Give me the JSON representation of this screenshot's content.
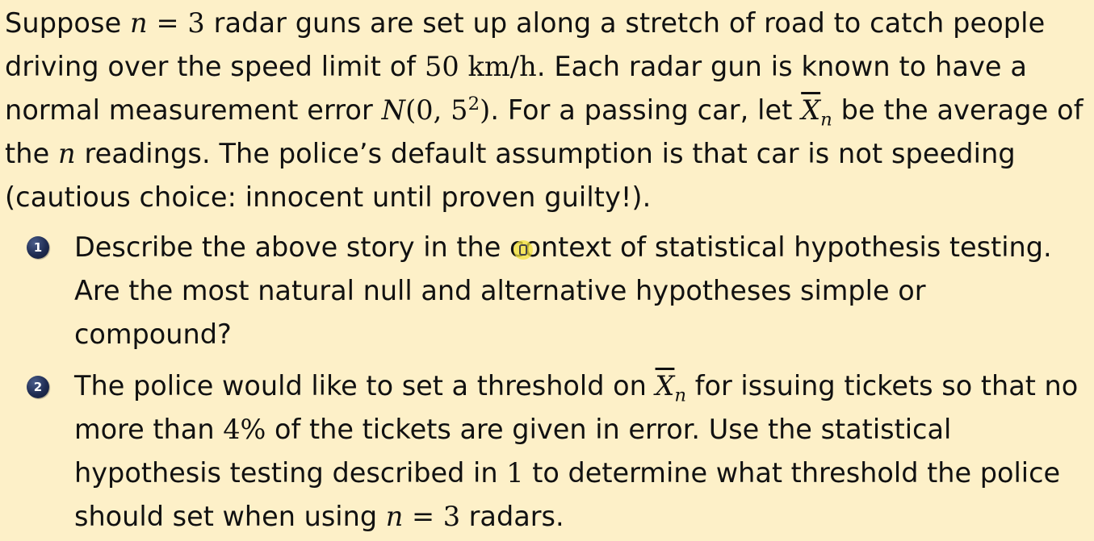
{
  "intro": {
    "s1": "Suppose ",
    "n1": "n",
    "eq1": " = 3",
    "s2": " radar guns are set up along a stretch of road to catch people driving over the speed limit of ",
    "speed": "50 km/h",
    "s3": ". Each radar gun is known to have a normal measurement error ",
    "dist": "N",
    "dist_args": "(0, 5",
    "dist_exp": "2",
    "dist_close": ")",
    "s4": ". For a passing car, let ",
    "xbar": "X",
    "xbar_sub": "n",
    "s5": " be the average of the ",
    "n2": "n",
    "s6": " readings. The police’s default assumption is that car is not speeding (cautious choice: innocent until proven guilty!)."
  },
  "items": [
    {
      "number": "1",
      "text": "Describe the above story in the context of statistical hypothesis testing. Are the most natural null and alternative hypotheses simple or compound?"
    },
    {
      "number": "2",
      "t1": "The police would like to set a threshold on ",
      "xbar": "X",
      "xbar_sub": "n",
      "t2": " for issuing tickets so that no more than ",
      "pct": "4%",
      "t3": " of the tickets are given in error. Use the statistical hypothesis testing described in ",
      "ref": "1",
      "t4": " to determine what threshold the police should set when using ",
      "n": "n",
      "eq": " = 3",
      "t5": " radars."
    }
  ],
  "cursor_icon": "text-cursor-icon",
  "accent_colors": {
    "background": "#fdf0c8",
    "bullet": "#1f2c52",
    "cursor_highlight": "#f0e13c"
  }
}
